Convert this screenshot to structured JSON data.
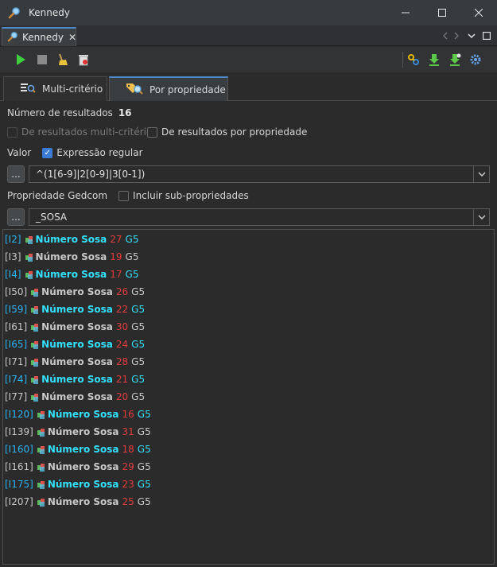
{
  "window": {
    "title": "Kennedy"
  },
  "view_tab": {
    "label": "Kennedy"
  },
  "mode_tabs": [
    {
      "label": "Multi-critério",
      "icon": "list-search-icon"
    },
    {
      "label": "Por propriedade",
      "icon": "tag-search-icon"
    }
  ],
  "results_count": {
    "label": "Número de resultados",
    "value": "16"
  },
  "filters": {
    "from_multi": "De resultados multi-critério",
    "from_property": "De resultados por propriedade"
  },
  "value": {
    "label": "Valor",
    "regex_label": "Expressão regular",
    "dots": "...",
    "text": "^(1[6-9]|2[0-9]|3[0-1])"
  },
  "property": {
    "label": "Propriedade Gedcom",
    "include_label": "Incluir sub-propriedades",
    "dots": "...",
    "text": "_SOSA"
  },
  "results": [
    {
      "id": "[I2]",
      "name": "Número Sosa",
      "sosa": "27",
      "gen": "G5",
      "hl": true
    },
    {
      "id": "[I3]",
      "name": "Número Sosa",
      "sosa": "19",
      "gen": "G5",
      "hl": false
    },
    {
      "id": "[I4]",
      "name": "Número Sosa",
      "sosa": "17",
      "gen": "G5",
      "hl": true
    },
    {
      "id": "[I50]",
      "name": "Número Sosa",
      "sosa": "26",
      "gen": "G5",
      "hl": false
    },
    {
      "id": "[I59]",
      "name": "Número Sosa",
      "sosa": "22",
      "gen": "G5",
      "hl": true
    },
    {
      "id": "[I61]",
      "name": "Número Sosa",
      "sosa": "30",
      "gen": "G5",
      "hl": false
    },
    {
      "id": "[I65]",
      "name": "Número Sosa",
      "sosa": "24",
      "gen": "G5",
      "hl": true
    },
    {
      "id": "[I71]",
      "name": "Número Sosa",
      "sosa": "28",
      "gen": "G5",
      "hl": false
    },
    {
      "id": "[I74]",
      "name": "Número Sosa",
      "sosa": "21",
      "gen": "G5",
      "hl": true
    },
    {
      "id": "[I77]",
      "name": "Número Sosa",
      "sosa": "20",
      "gen": "G5",
      "hl": false
    },
    {
      "id": "[I120]",
      "name": "Número Sosa",
      "sosa": "16",
      "gen": "G5",
      "hl": true
    },
    {
      "id": "[I139]",
      "name": "Número Sosa",
      "sosa": "31",
      "gen": "G5",
      "hl": false
    },
    {
      "id": "[I160]",
      "name": "Número Sosa",
      "sosa": "18",
      "gen": "G5",
      "hl": true
    },
    {
      "id": "[I161]",
      "name": "Número Sosa",
      "sosa": "29",
      "gen": "G5",
      "hl": false
    },
    {
      "id": "[I175]",
      "name": "Número Sosa",
      "sosa": "23",
      "gen": "G5",
      "hl": true
    },
    {
      "id": "[I207]",
      "name": "Número Sosa",
      "sosa": "25",
      "gen": "G5",
      "hl": false
    }
  ]
}
